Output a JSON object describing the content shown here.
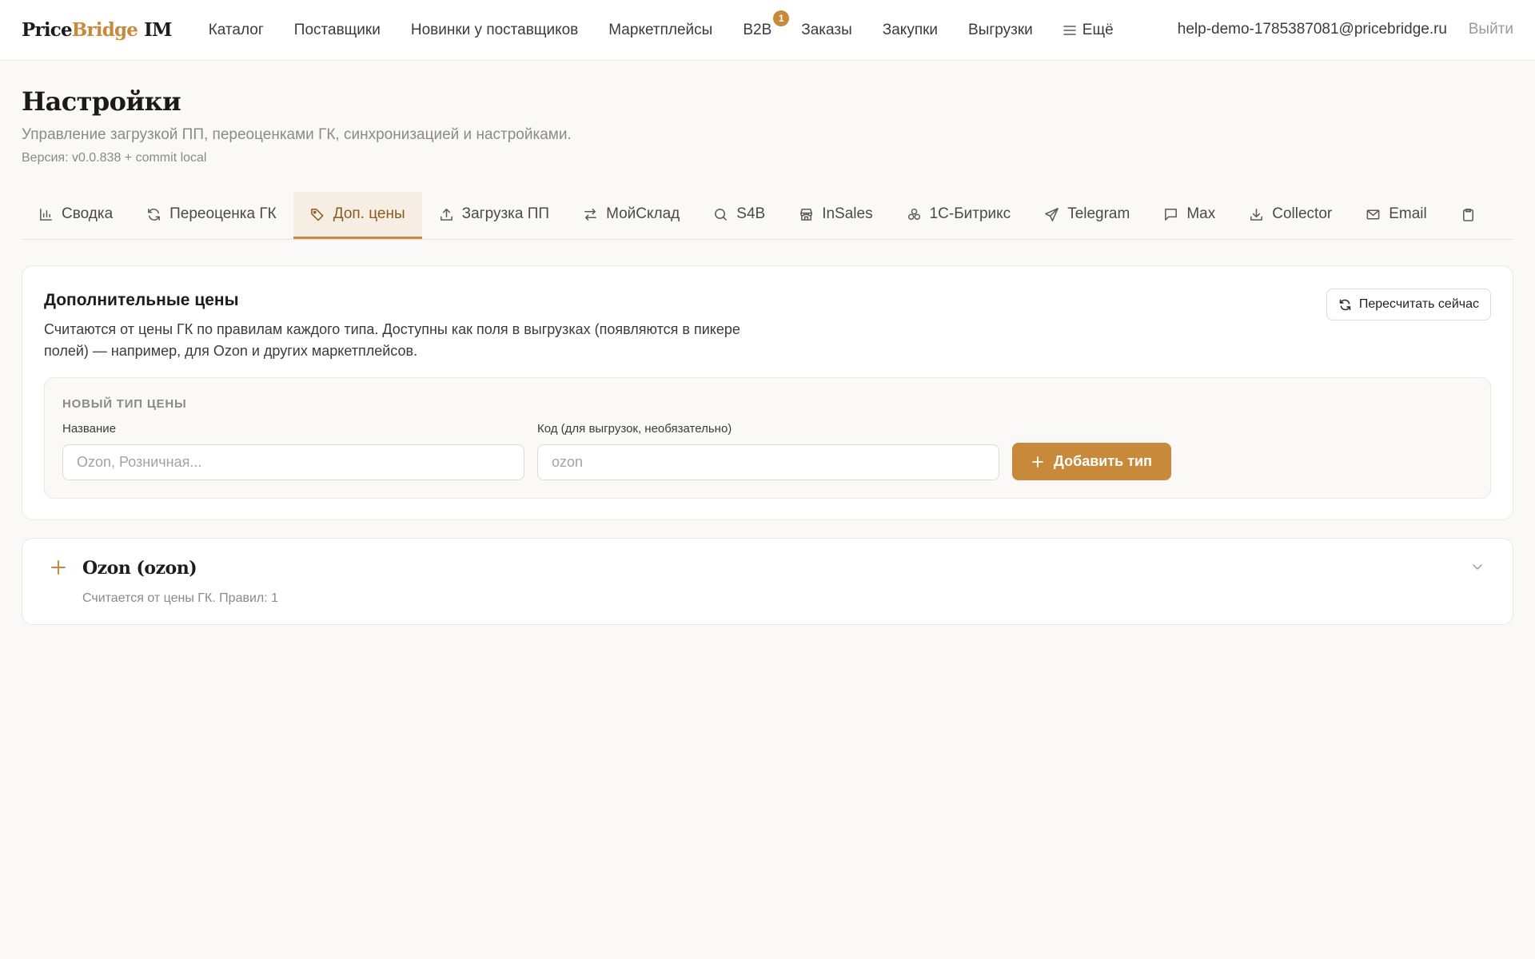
{
  "brand": {
    "part1": "Price",
    "part2": "Bridge",
    "part3": "IM",
    "accent_color": "#c8893a"
  },
  "nav": {
    "items": [
      {
        "label": "Каталог"
      },
      {
        "label": "Поставщики"
      },
      {
        "label": "Новинки у поставщиков"
      },
      {
        "label": "Маркетплейсы"
      },
      {
        "label": "B2B",
        "badge": "1"
      },
      {
        "label": "Заказы"
      },
      {
        "label": "Закупки"
      },
      {
        "label": "Выгрузки"
      },
      {
        "label": "Ещё",
        "icon": "menu-icon"
      }
    ],
    "user_email": "help-demo-1785387081@pricebridge.ru",
    "logout_label": "Выйти"
  },
  "header": {
    "title": "Настройки",
    "subtitle": "Управление загрузкой ПП, переоценками ГК, синхронизацией и настройками.",
    "version": "Версия: v0.0.838 + commit local"
  },
  "tabs": [
    {
      "label": "Сводка",
      "icon": "bar-chart-icon",
      "active": false
    },
    {
      "label": "Переоценка ГК",
      "icon": "refresh-icon",
      "active": false
    },
    {
      "label": "Доп. цены",
      "icon": "tag-icon",
      "active": true
    },
    {
      "label": "Загрузка ПП",
      "icon": "upload-icon",
      "active": false
    },
    {
      "label": "МойСклад",
      "icon": "arrows-swap-icon",
      "active": false
    },
    {
      "label": "S4B",
      "icon": "search-icon",
      "active": false
    },
    {
      "label": "InSales",
      "icon": "store-icon",
      "active": false
    },
    {
      "label": "1С-Битрикс",
      "icon": "cluster-icon",
      "active": false
    },
    {
      "label": "Telegram",
      "icon": "send-icon",
      "active": false
    },
    {
      "label": "Max",
      "icon": "message-icon",
      "active": false
    },
    {
      "label": "Collector",
      "icon": "download-icon",
      "active": false
    },
    {
      "label": "Email",
      "icon": "mail-icon",
      "active": false
    },
    {
      "label": "",
      "icon": "clipboard-icon",
      "active": false
    }
  ],
  "prices_card": {
    "title": "Дополнительные цены",
    "description": "Считаются от цены ГК по правилам каждого типа. Доступны как поля в выгрузках (появляются в пикере полей) — например, для Ozon и других маркетплейсов.",
    "recalc_label": "Пересчитать сейчас",
    "new_type": {
      "heading": "НОВЫЙ ТИП ЦЕНЫ",
      "name_label": "Название",
      "name_placeholder": "Ozon, Розничная...",
      "name_value": "",
      "code_label": "Код (для выгрузок, необязательно)",
      "code_placeholder": "ozon",
      "code_value": "",
      "add_label": "Добавить тип"
    }
  },
  "price_types": [
    {
      "title": "Ozon (ozon)",
      "subtitle": "Считается от цены ГК. Правил: 1"
    }
  ]
}
